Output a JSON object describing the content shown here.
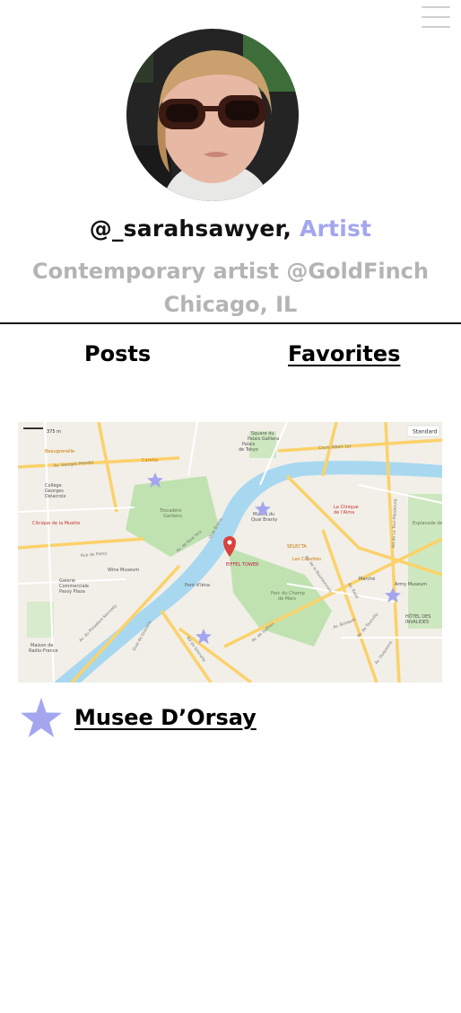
{
  "profile": {
    "handle": "@_sarahsawyer,",
    "role": "Artist",
    "bio": "Contemporary artist @GoldFinch",
    "location": "Chicago, IL",
    "avatar_desc": "user-avatar"
  },
  "tabs": [
    {
      "label": "Posts",
      "active": false
    },
    {
      "label": "Favorites",
      "active": true
    }
  ],
  "map": {
    "scale": "375 m",
    "view_mode": "Standard",
    "streets": [
      "Av. Georges Mandel",
      "Rue de Passy",
      "Av. de New York",
      "Quai Branly",
      "Av. du Président Kennedy",
      "Quai de Grenelle",
      "Bd de Grenelle",
      "Av. de Suffren",
      "Av. de la Bourdonnais",
      "Cours Albert 1er",
      "Bd de La Tour-Maubourg",
      "Av. de Tourville",
      "Av. Bosquet",
      "Av. Rapp",
      "Av. Duquesne"
    ],
    "places": [
      "Trocadéro Gardens",
      "Palais de Tokyo",
      "Musée du Quai Branly",
      "Parc du Champ de Mars",
      "EIFFEL TOWER",
      "Army Museum",
      "HÔTEL DES INVALIDES",
      "Maison de Radio-France",
      "Wine Museum",
      "Galerie Commerciale Passy Plaza",
      "Clinique de la Muette",
      "Collège Georges Delacroix",
      "Beaugrenelle",
      "Square du Palais Galliera",
      "La Clinique de l'Alma",
      "SELECTA",
      "Les Cocottes",
      "Marché Saxe-Breteuil",
      "Pont d'Iéna",
      "Carette"
    ],
    "accent_color": "#a3a6ee",
    "pin_color": "#d9423a"
  },
  "favorite": {
    "name": "Musee D’Orsay",
    "star_color": "#a3a6ee"
  }
}
